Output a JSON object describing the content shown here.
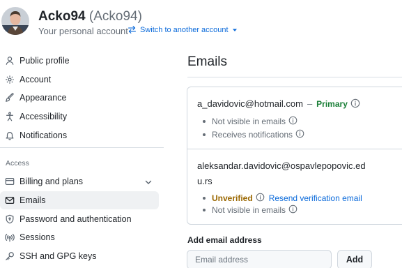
{
  "header": {
    "display_name": "Acko94",
    "handle": "(Acko94)",
    "subtitle": "Your personal account",
    "switch_label": "Switch to another account"
  },
  "sidebar": {
    "items": [
      {
        "label": "Public profile",
        "icon": "person-icon"
      },
      {
        "label": "Account",
        "icon": "gear-icon"
      },
      {
        "label": "Appearance",
        "icon": "paintbrush-icon"
      },
      {
        "label": "Accessibility",
        "icon": "accessibility-icon"
      },
      {
        "label": "Notifications",
        "icon": "bell-icon"
      }
    ],
    "section_label": "Access",
    "access_items": [
      {
        "label": "Billing and plans",
        "icon": "credit-card-icon"
      },
      {
        "label": "Emails",
        "icon": "mail-icon",
        "active": true
      },
      {
        "label": "Password and authentication",
        "icon": "shield-lock-icon"
      },
      {
        "label": "Sessions",
        "icon": "broadcast-icon"
      },
      {
        "label": "SSH and GPG keys",
        "icon": "key-icon"
      }
    ]
  },
  "main": {
    "title": "Emails",
    "emails": [
      {
        "address": "a_davidovic@hotmail.com",
        "dash": "–",
        "badge": "Primary",
        "details": [
          "Not visible in emails",
          "Receives notifications"
        ]
      },
      {
        "address": "aleksandar.davidovic@ospavlepopovic.edu.rs",
        "status": "Unverified",
        "action": "Resend verification email",
        "details": [
          "Not visible in emails"
        ]
      }
    ],
    "add": {
      "label": "Add email address",
      "placeholder": "Email address",
      "button": "Add"
    }
  },
  "colors": {
    "accent": "#0969da",
    "primary_badge": "#1a7f37",
    "unverified": "#9a6700",
    "active_nav_bg": "#eff1f3"
  }
}
